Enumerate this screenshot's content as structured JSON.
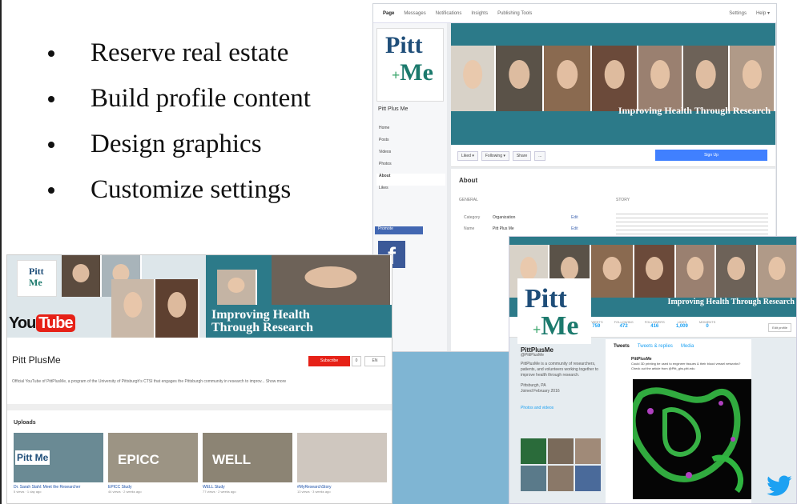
{
  "slide": {
    "bullets": [
      "Reserve real estate",
      "Build profile content",
      "Design graphics",
      "Customize settings"
    ]
  },
  "colors": {
    "facebook_blue": "#3b5998",
    "youtube_red": "#e62117",
    "twitter_blue": "#1da1f2",
    "cover_teal": "#2c7a89",
    "accent_bg": "#7fb5d3"
  },
  "pitt_logo": {
    "line1": "Pitt",
    "plus": "+",
    "line2": "Me"
  },
  "cover_tagline": "Improving Health Through Research",
  "facebook": {
    "tabs": [
      "Page",
      "Messages",
      "Notifications",
      "Insights",
      "Publishing Tools"
    ],
    "tabs_right": [
      "Settings",
      "Help ▾"
    ],
    "page_name": "Pitt Plus Me",
    "nav": [
      "Home",
      "Posts",
      "Videos",
      "Photos",
      "About",
      "Likes"
    ],
    "active_nav": "About",
    "promote": "Promote",
    "actions": [
      "Liked ▾",
      "Following ▾",
      "Share",
      "..."
    ],
    "signup": "Sign Up",
    "about_title": "About",
    "general_label": "GENERAL",
    "story_label": "STORY",
    "category_label": "Category",
    "category_value": "Organization",
    "name_label": "Name",
    "name_value": "Pitt Plus Me",
    "edit_label": "Edit"
  },
  "youtube": {
    "logo_you": "You",
    "logo_tube": "Tube",
    "tagline_line1": "Improving Health",
    "tagline_line2": "Through Research",
    "channel_name": "Pitt PlusMe",
    "subscribe": "Subscribe",
    "sub_count": "0",
    "language": "EN",
    "description": "Official YouTube of PittPlusMe, a program of the University of Pittsburgh's CTSI that engages the Pittsburgh community in research to improv... Show more",
    "uploads_label": "Uploads",
    "videos": [
      {
        "title": "Dr. Sarah Stahl: Meet the Researcher",
        "meta": "5 views · 1 day ago",
        "thumb_text": "Pitt Me"
      },
      {
        "title": "EPICC Study",
        "meta": "44 views · 2 weeks ago",
        "thumb_text": "EPICC"
      },
      {
        "title": "WELL Study",
        "meta": "77 views · 2 weeks ago",
        "thumb_text": "WELL"
      },
      {
        "title": "#MyResearchStory",
        "meta": "13 views · 3 weeks ago",
        "thumb_text": ""
      }
    ]
  },
  "twitter": {
    "profile_name": "PittPlusMe",
    "handle": "@PittPlusMe",
    "stats": [
      {
        "label": "TWEETS",
        "value": "759"
      },
      {
        "label": "FOLLOWING",
        "value": "472"
      },
      {
        "label": "FOLLOWERS",
        "value": "416"
      },
      {
        "label": "LIKES",
        "value": "1,009"
      },
      {
        "label": "MOMENTS",
        "value": "0"
      }
    ],
    "edit_profile": "Edit profile",
    "bio": "PittPlusMe is a community of researchers, patients, and volunteers working together to improve health through research.",
    "location": "Pittsburgh, PA",
    "joined": "Joined February 2016",
    "photos_label": "Photos and videos",
    "feed_tabs": [
      "Tweets",
      "Tweets & replies",
      "Media"
    ],
    "tweet_author": "PittPlusMe",
    "tweet_text": "Could 3D printing be used to engineer tissues & their blood vessel networks? Check out the article from @Pitt_ghs.pitt.edu"
  }
}
